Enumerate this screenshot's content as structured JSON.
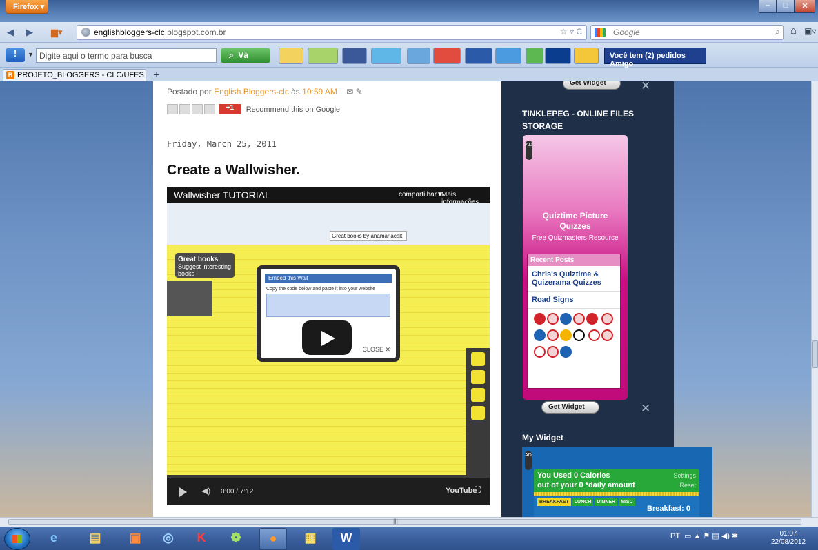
{
  "browser": {
    "menu_label": "Firefox",
    "url_host": "englishbloggers-clc",
    "url_rest": ".blogspot.com.br",
    "search_engine": "Google",
    "tab_title": "PROJETO_BLOGGERS - CLC/UFES"
  },
  "toolbar": {
    "search_placeholder": "Digite aqui o termo para busca",
    "go_label": "Vá",
    "friends_label": "Você tem (2) pedidos Amigo",
    "icons": [
      "percent-icon",
      "game-icon",
      "facebook-icon",
      "twitter-icon",
      "messenger-icon",
      "pdf-icon",
      "word-icon",
      "weather-icon",
      "windows-icon",
      "keyboard-icon",
      "sun-icon"
    ]
  },
  "post": {
    "posted_by_prefix": "Postado por",
    "author": "English.Bloggers-clc",
    "at_word": "às",
    "time": "10:59 AM",
    "recommend_label": "Recommend this on Google",
    "gplus_label": "+1",
    "date": "Friday, March 25, 2011",
    "title": "Create a Wallwisher."
  },
  "video": {
    "title": "Wallwisher TUTORIAL",
    "share_label": "compartilhar",
    "more_label": "Mais informações",
    "tab_label": "Great books by anamariacalt",
    "board_title": "Great books",
    "board_subtitle": "Suggest interesting books",
    "embed_header": "Embed this Wall",
    "embed_text": "Copy the code below and paste it into your website",
    "close_label": "CLOSE ✕",
    "time_current": "0:00",
    "time_total": "7:12",
    "brand": "YouTube",
    "progress_fraction": 0
  },
  "sidebar": {
    "get_widget_label": "Get Widget",
    "tinkle_title": "TINKLEPEG - ONLINE FILES STORAGE",
    "quiz_title": "Quiztime Picture Quizzes",
    "quiz_subtitle": "Free Quizmasters Resource",
    "recent_header": "Recent Posts",
    "recent_items": [
      "Chris's Quiztime & Quizerama Quizzes",
      "Road Signs"
    ],
    "my_widget_title": "My Widget",
    "ad_label": "AD"
  },
  "calorie_widget": {
    "line1": "You Used 0 Calories",
    "line2": "out of your 0 *daily amount",
    "settings": "Settings",
    "reset": "Reset",
    "meals": [
      "BREAKFAST",
      "LUNCH",
      "DINNER",
      "MISC"
    ],
    "breakfast_total": "Breakfast: 0"
  },
  "taskbar": {
    "language": "PT",
    "time": "01:07",
    "date": "22/08/2012",
    "apps": [
      "ie-icon",
      "explorer-icon",
      "media-player-icon",
      "chrome-like-icon",
      "kaspersky-icon",
      "msn-icon",
      "firefox-icon",
      "movie-maker-icon",
      "word-icon"
    ]
  },
  "colors": {
    "accent_orange": "#e8982b",
    "sidebar_bg": "#1f2f47",
    "tinkle_pink": "#c90f82",
    "calorie_green": "#29a83a"
  }
}
